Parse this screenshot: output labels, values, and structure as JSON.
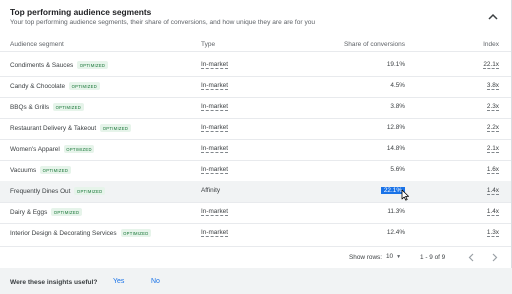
{
  "header": {
    "title": "Top performing audience segments",
    "subtitle": "Your top performing audience segments, their share of conversions, and how unique they are are for you"
  },
  "table": {
    "columns": {
      "segment": "Audience segment",
      "type": "Type",
      "share": "Share of conversions",
      "index": "Index"
    },
    "rows": [
      {
        "segment": "Condiments & Sauces",
        "badge": "OPTIMIZED",
        "type": "In-market",
        "share": "19.1%",
        "index": "22.1x"
      },
      {
        "segment": "Candy & Chocolate",
        "badge": "OPTIMIZED",
        "type": "In-market",
        "share": "4.5%",
        "index": "3.8x"
      },
      {
        "segment": "BBQs & Grills",
        "badge": "OPTIMIZED",
        "type": "In-market",
        "share": "3.8%",
        "index": "2.3x"
      },
      {
        "segment": "Restaurant Delivery & Takeout",
        "badge": "OPTIMIZED",
        "type": "In-market",
        "share": "12.8%",
        "index": "2.2x"
      },
      {
        "segment": "Women's Apparel",
        "badge": "OPTIMIZED",
        "type": "In-market",
        "share": "14.8%",
        "index": "2.1x"
      },
      {
        "segment": "Vacuums",
        "badge": "OPTIMIZED",
        "type": "In-market",
        "share": "5.6%",
        "index": "1.6x"
      },
      {
        "segment": "Frequently Dines Out",
        "badge": "OPTIMIZED",
        "type": "Affinity",
        "share": "22.1%",
        "index": "1.4x"
      },
      {
        "segment": "Dairy & Eggs",
        "badge": "OPTIMIZED",
        "type": "In-market",
        "share": "11.3%",
        "index": "1.4x"
      },
      {
        "segment": "Interior Design & Decorating Services",
        "badge": "OPTIMIZED",
        "type": "In-market",
        "share": "12.4%",
        "index": "1.3x"
      }
    ]
  },
  "pagination": {
    "show_rows_label": "Show rows:",
    "rows_value": "10",
    "range": "1 - 9 of 9"
  },
  "feedback": {
    "question": "Were these insights useful?",
    "yes": "Yes",
    "no": "No"
  },
  "icons": {
    "collapse": "chevron-up-icon",
    "prev": "chevron-left-icon",
    "next": "chevron-right-icon",
    "dropdown": "caret-down-icon",
    "cursor": "mouse-pointer-icon"
  },
  "colors": {
    "accent": "#1a73e8",
    "badge_bg": "#e6f4ea",
    "badge_text": "#137333"
  }
}
